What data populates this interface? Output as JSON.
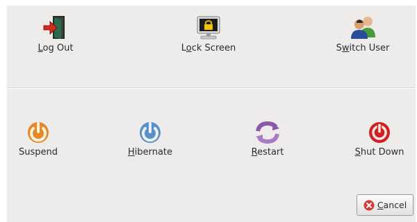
{
  "dialog": {
    "top_actions": [
      {
        "mnemonic": "L",
        "rest": "og Out",
        "icon": "log-out-icon"
      },
      {
        "pre": "L",
        "mnemonic": "o",
        "rest": "ck Screen",
        "icon": "lock-screen-icon"
      },
      {
        "pre": "S",
        "mnemonic": "w",
        "rest": "itch User",
        "icon": "switch-user-icon"
      }
    ],
    "bottom_actions": [
      {
        "label": "Suspend",
        "icon": "suspend-icon"
      },
      {
        "mnemonic": "H",
        "rest": "ibernate",
        "icon": "hibernate-icon"
      },
      {
        "mnemonic": "R",
        "rest": "estart",
        "icon": "restart-icon"
      },
      {
        "mnemonic": "S",
        "rest": "hut Down",
        "icon": "shut-down-icon"
      }
    ],
    "cancel": {
      "mnemonic": "C",
      "rest": "ancel",
      "icon": "cancel-icon"
    },
    "colors": {
      "background": "#edeceb",
      "suspend": "#e8872a",
      "hibernate": "#5b8fc6",
      "restart": "#8a58a8",
      "shut_down": "#d02020",
      "cancel_icon": "#d63a3a"
    }
  }
}
